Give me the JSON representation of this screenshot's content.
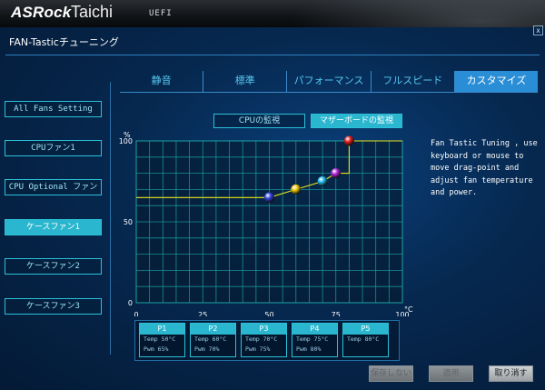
{
  "brand": {
    "name": "ASRock",
    "product": "Taichi",
    "mode": "UEFI"
  },
  "window": {
    "title": "FAN-Tasticチューニング",
    "close_label": "x"
  },
  "tabs": [
    {
      "label": "静音",
      "active": false
    },
    {
      "label": "標準",
      "active": false
    },
    {
      "label": "パフォーマンス",
      "active": false
    },
    {
      "label": "フルスピード",
      "active": false
    },
    {
      "label": "カスタマイズ",
      "active": true
    }
  ],
  "sidebar": {
    "items": [
      {
        "label": "All Fans Setting",
        "active": false
      },
      {
        "label": "CPUファン1",
        "active": false
      },
      {
        "label": "CPU Optional ファン",
        "active": false
      },
      {
        "label": "ケースファン1",
        "active": true
      },
      {
        "label": "ケースファン2",
        "active": false
      },
      {
        "label": "ケースファン3",
        "active": false
      }
    ]
  },
  "mode_toggle": {
    "cpu_label": "CPUの監視",
    "mb_label": "マザーボードの監視",
    "selected": "mb"
  },
  "chart_data": {
    "type": "line",
    "xlabel": "°C",
    "ylabel": "%",
    "xlim": [
      0,
      100
    ],
    "ylim": [
      0,
      100
    ],
    "x_ticks": [
      0,
      25,
      50,
      75,
      100
    ],
    "x_tick_labels": [
      "0",
      "25",
      "50",
      "75",
      "100"
    ],
    "y_ticks": [
      0,
      50,
      100
    ],
    "y_tick_labels": [
      "0",
      "50",
      "100"
    ],
    "grid": true,
    "curve": [
      {
        "x": 0,
        "y": 65
      },
      {
        "x": 50,
        "y": 65
      },
      {
        "x": 60,
        "y": 70
      },
      {
        "x": 70,
        "y": 75
      },
      {
        "x": 75,
        "y": 80
      },
      {
        "x": 80,
        "y": 80
      },
      {
        "x": 80,
        "y": 100
      },
      {
        "x": 100,
        "y": 100
      }
    ],
    "points": [
      {
        "name": "P1",
        "x": 50,
        "y": 65,
        "color": "#2f3fe0"
      },
      {
        "name": "P2",
        "x": 60,
        "y": 70,
        "color": "#e8c400"
      },
      {
        "name": "P3",
        "x": 70,
        "y": 75,
        "color": "#18b4e6"
      },
      {
        "name": "P4",
        "x": 75,
        "y": 80,
        "color": "#b21fd6"
      },
      {
        "name": "P5",
        "x": 80,
        "y": 100,
        "color": "#e01818"
      }
    ],
    "line_color": "#e6e61a",
    "grid_color": "#1aa3a3"
  },
  "help_text": "Fan Tastic Tuning , use keyboard or mouse to move drag-point and adjust fan temperature and power.",
  "points": [
    {
      "label": "P1",
      "temp": "Temp 50°C",
      "pwm": "Pwm  65%"
    },
    {
      "label": "P2",
      "temp": "Temp 60°C",
      "pwm": "Pwm  70%"
    },
    {
      "label": "P3",
      "temp": "Temp 70°C",
      "pwm": "Pwm  75%"
    },
    {
      "label": "P4",
      "temp": "Temp 75°C",
      "pwm": "Pwm  80%"
    },
    {
      "label": "P5",
      "temp": "Temp 80°C",
      "pwm": ""
    }
  ],
  "buttons": {
    "save": "保存しない",
    "apply": "適用",
    "cancel": "取り消す"
  },
  "colors": {
    "accent": "#2bb6cf",
    "tab_active": "#2a8ed6",
    "tab_text": "#56c7f0"
  }
}
